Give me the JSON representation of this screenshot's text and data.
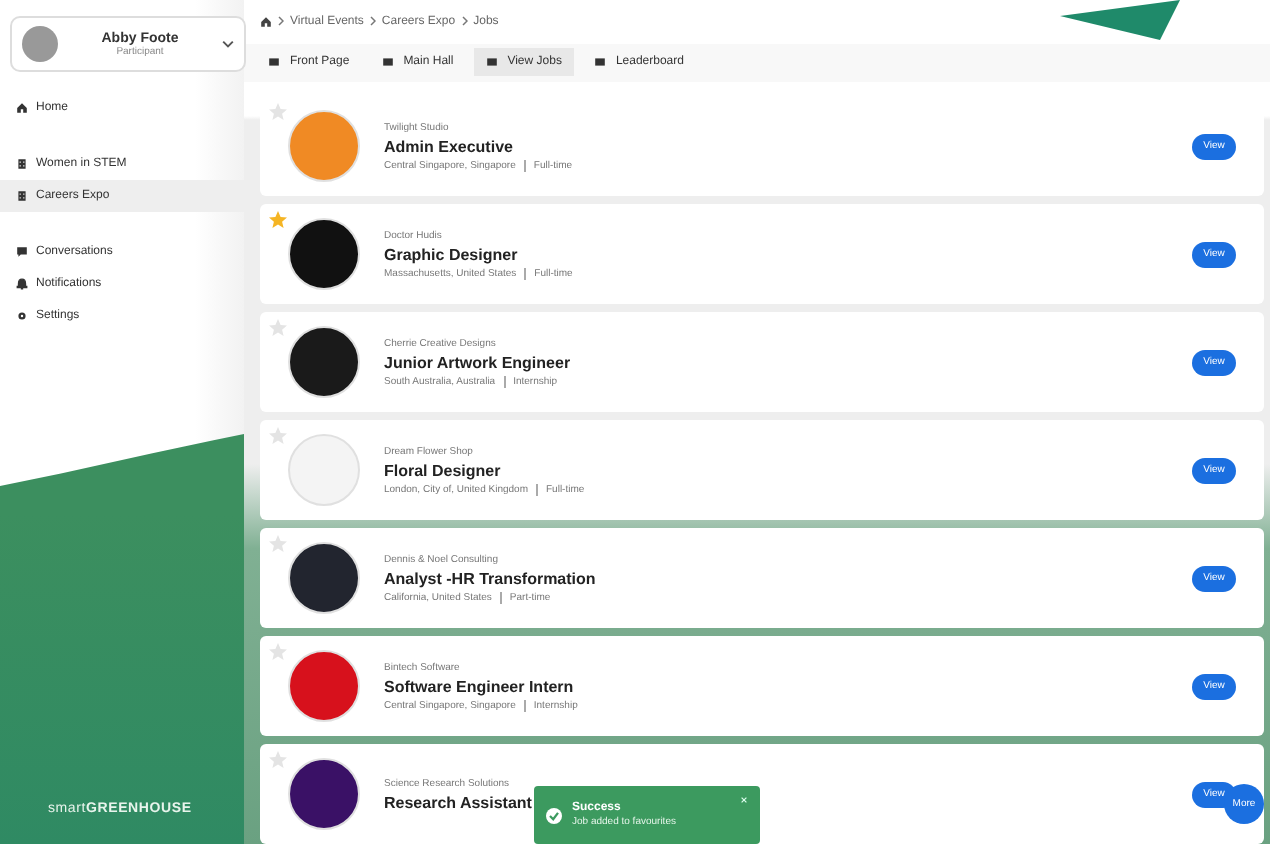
{
  "profile": {
    "name": "Abby Foote",
    "role": "Participant"
  },
  "nav": [
    {
      "label": "Home",
      "selected": false
    },
    {
      "label": "Women in STEM",
      "selected": false
    },
    {
      "label": "Careers Expo",
      "selected": true
    },
    {
      "label": "Conversations",
      "selected": false
    },
    {
      "label": "Notifications",
      "selected": false
    },
    {
      "label": "Settings",
      "selected": false
    }
  ],
  "brand": "smart**GREENHOUSE**",
  "breadcrumb": [
    "Virtual Events",
    "Careers Expo",
    "Jobs"
  ],
  "tabs": [
    {
      "label": "Front Page",
      "selected": false
    },
    {
      "label": "Main Hall",
      "selected": false
    },
    {
      "label": "View Jobs",
      "selected": true
    },
    {
      "label": "Leaderboard",
      "selected": false
    }
  ],
  "jobs": [
    {
      "company": "Twilight Studio",
      "title": "Admin Executive",
      "location": "Central Singapore, Singapore",
      "type": "Full-time",
      "color": "#f08a24",
      "starred": false,
      "button": "View"
    },
    {
      "company": "Doctor Hudis",
      "title": "Graphic Designer",
      "location": "Massachusetts, United States",
      "type": "Full-time",
      "color": "#111111",
      "starred": true,
      "button": "View"
    },
    {
      "company": "Cherrie Creative Designs",
      "title": "Junior Artwork Engineer",
      "location": "South Australia, Australia",
      "type": "Internship",
      "color": "#1a1a1a",
      "starred": false,
      "button": "View"
    },
    {
      "company": "Dream Flower Shop",
      "title": "Floral Designer",
      "location": "London, City of, United Kingdom",
      "type": "Full-time",
      "color": "#f4f4f4",
      "starred": false,
      "button": "View"
    },
    {
      "company": "Dennis & Noel Consulting",
      "title": "Analyst -HR Transformation",
      "location": "California, United States",
      "type": "Part-time",
      "color": "#22252f",
      "starred": false,
      "button": "View"
    },
    {
      "company": "Bintech Software",
      "title": "Software Engineer Intern",
      "location": "Central Singapore, Singapore",
      "type": "Internship",
      "color": "#d7111c",
      "starred": false,
      "button": "View"
    },
    {
      "company": "Science Research Solutions",
      "title": "Research Assistant",
      "color": "#3a1166",
      "starred": false,
      "button": "View"
    }
  ],
  "toast": {
    "title": "Success",
    "message": "Job added to favourites"
  },
  "more_button": "More"
}
